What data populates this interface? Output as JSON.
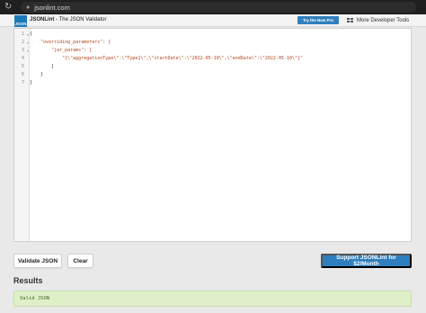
{
  "browser": {
    "url": "jsonlint.com"
  },
  "header": {
    "logo_text": "JSON",
    "brand_name": "JSONLint",
    "brand_tagline": " - The JSON Validator",
    "try_pro_label": "Try the New Pro",
    "more_tools_label": "More Developer Tools"
  },
  "editor": {
    "lines": [
      {
        "num": "1",
        "fold": "▾",
        "text": "{"
      },
      {
        "num": "2",
        "fold": "▾",
        "text": "    \"overriding_parameters\": {"
      },
      {
        "num": "3",
        "fold": "▾",
        "text": "        \"jar_params\": ["
      },
      {
        "num": "4",
        "fold": "",
        "text": "            \"{\\\"aggregationType\\\":\\\"Type1\\\",\\\"startDate\\\":\\\"2022-05-10\\\",\\\"endDate\\\":\\\"2022-05-10\\\"}\""
      },
      {
        "num": "5",
        "fold": "",
        "text": "        ]"
      },
      {
        "num": "6",
        "fold": "",
        "text": "    }"
      },
      {
        "num": "7",
        "fold": "",
        "text": "}"
      }
    ]
  },
  "actions": {
    "validate_label": "Validate JSON",
    "clear_label": "Clear",
    "support_label": "Support JSONLint for $2/Month"
  },
  "results": {
    "title": "Results",
    "message": "Valid JSON"
  },
  "colors": {
    "brand_blue": "#2f7fbe",
    "success_bg": "#dff0c9",
    "success_text": "#3c6b1e"
  }
}
